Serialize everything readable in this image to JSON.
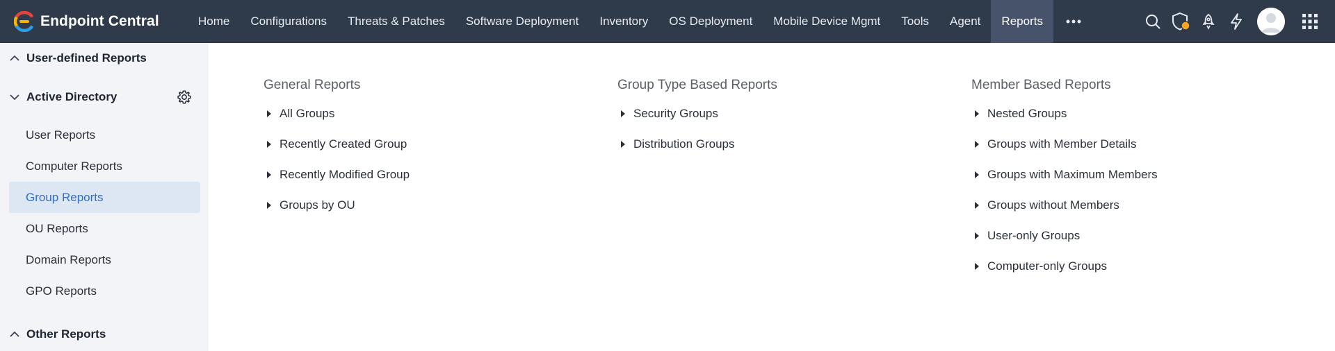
{
  "header": {
    "brand": "Endpoint Central",
    "nav": [
      {
        "label": "Home"
      },
      {
        "label": "Configurations"
      },
      {
        "label": "Threats & Patches"
      },
      {
        "label": "Software Deployment"
      },
      {
        "label": "Inventory"
      },
      {
        "label": "OS Deployment"
      },
      {
        "label": "Mobile Device Mgmt"
      },
      {
        "label": "Tools"
      },
      {
        "label": "Agent"
      },
      {
        "label": "Reports"
      }
    ],
    "active_nav": "Reports",
    "icons": [
      "more-icon",
      "search-icon",
      "shield-alert-icon",
      "rocket-icon",
      "lightning-icon",
      "avatar",
      "apps-grid-icon"
    ],
    "notification_dot_color": "#f5a623"
  },
  "sidebar": {
    "user_defined": "User-defined Reports",
    "active_directory": "Active Directory",
    "items": [
      {
        "label": "User Reports"
      },
      {
        "label": "Computer Reports"
      },
      {
        "label": "Group Reports"
      },
      {
        "label": "OU Reports"
      },
      {
        "label": "Domain Reports"
      },
      {
        "label": "GPO Reports"
      }
    ],
    "active_item": "Group Reports",
    "other_reports": "Other Reports"
  },
  "main": {
    "columns": [
      {
        "title": "General Reports",
        "reports": [
          "All Groups",
          "Recently Created Group",
          "Recently Modified Group",
          "Groups by OU"
        ]
      },
      {
        "title": "Group Type Based Reports",
        "reports": [
          "Security Groups",
          "Distribution Groups"
        ]
      },
      {
        "title": "Member Based Reports",
        "reports": [
          "Nested Groups",
          "Groups with Member Details",
          "Groups with Maximum Members",
          "Groups without Members",
          "User-only Groups",
          "Computer-only Groups"
        ]
      }
    ]
  },
  "colors": {
    "topbar": "#2f3a4b",
    "active_nav": "#46536a",
    "sidebar_bg": "#f3f4f8",
    "sidebar_active_bg": "#dde7f3",
    "sidebar_active_text": "#2f6ec4"
  }
}
